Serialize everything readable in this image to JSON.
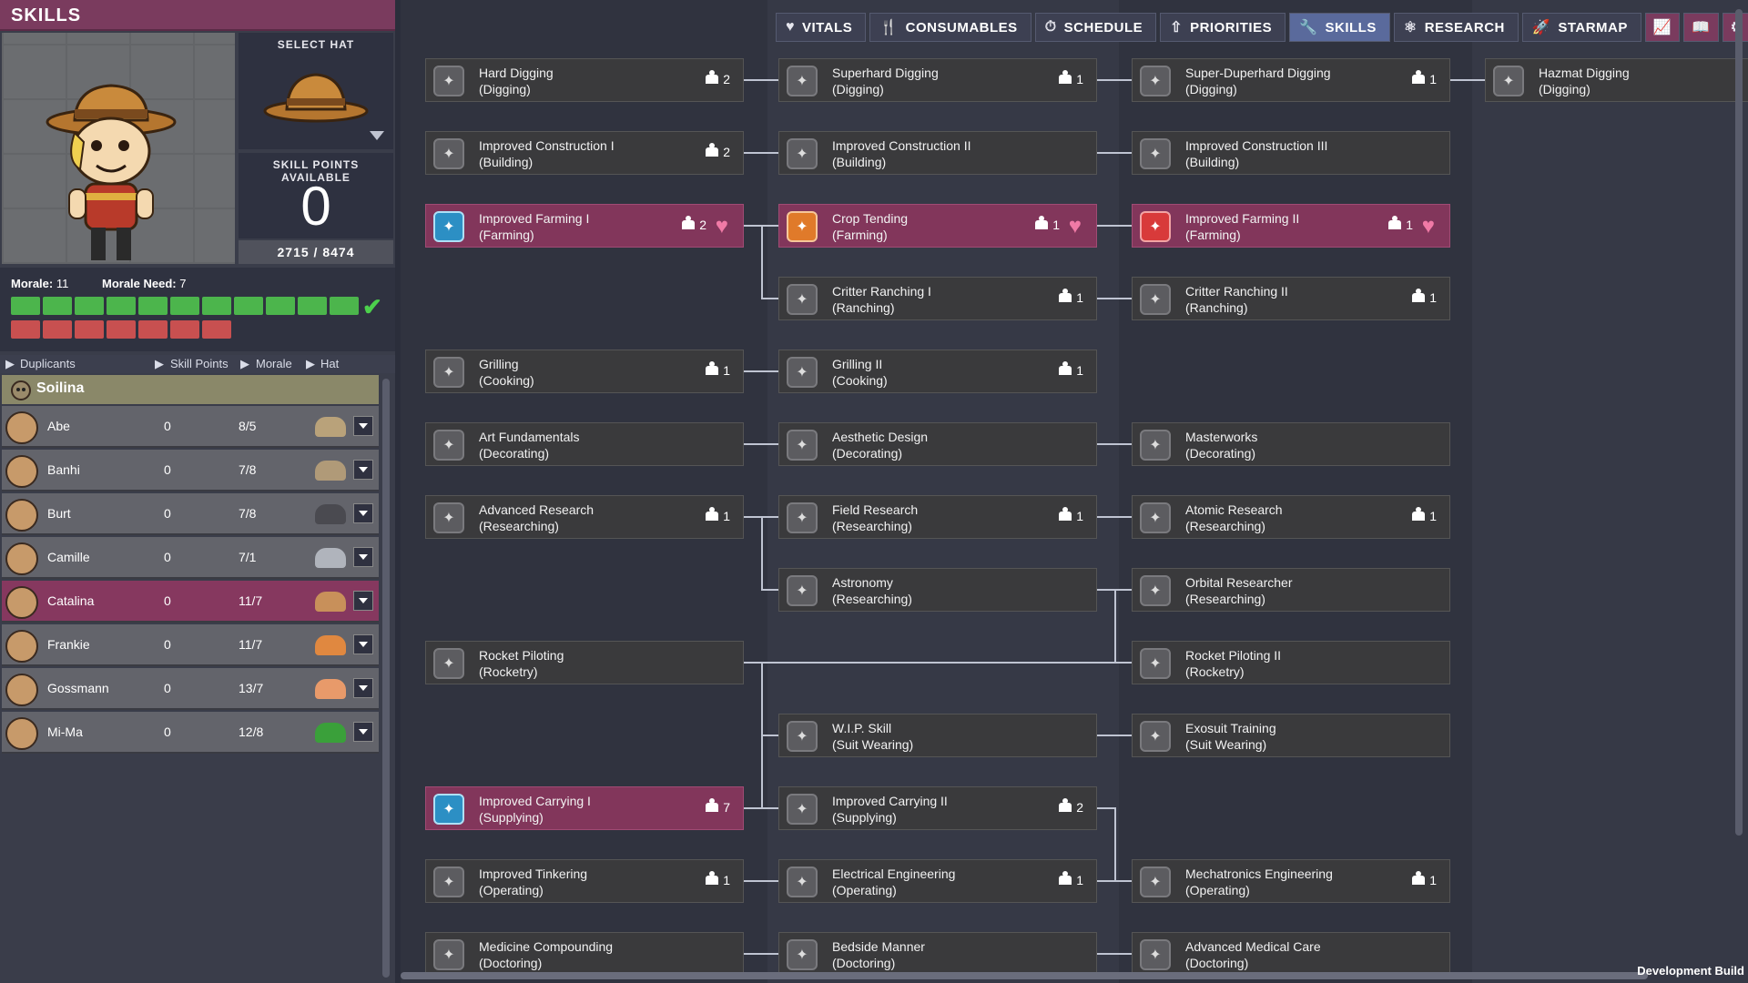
{
  "left": {
    "title": "SKILLS",
    "select_hat_label": "SELECT HAT",
    "skill_points_label": "SKILL POINTS AVAILABLE",
    "skill_points": "0",
    "xp": "2715 / 8474",
    "morale_label": "Morale:",
    "morale_value": "11",
    "morale_need_label": "Morale Need:",
    "morale_need_value": "7",
    "morale_green_cells": 11,
    "morale_red_cells": 7,
    "headers": [
      "Duplicants",
      "Skill Points",
      "Morale",
      "Hat"
    ],
    "group": "Soilina",
    "duplicants": [
      {
        "name": "Abe",
        "points": "0",
        "morale": "8/5",
        "hat_color": "#b9a27a"
      },
      {
        "name": "Banhi",
        "points": "0",
        "morale": "7/8",
        "hat_color": "#b09a78"
      },
      {
        "name": "Burt",
        "points": "0",
        "morale": "7/8",
        "hat_color": "#4a4a50"
      },
      {
        "name": "Camille",
        "points": "0",
        "morale": "7/1",
        "hat_color": "#b0b4bc"
      },
      {
        "name": "Catalina",
        "points": "0",
        "morale": "11/7",
        "hat_color": "#c8905a",
        "selected": true
      },
      {
        "name": "Frankie",
        "points": "0",
        "morale": "11/7",
        "hat_color": "#e08840"
      },
      {
        "name": "Gossmann",
        "points": "0",
        "morale": "13/7",
        "hat_color": "#e89a6a"
      },
      {
        "name": "Mi-Ma",
        "points": "0",
        "morale": "12/8",
        "hat_color": "#3aa03a"
      }
    ]
  },
  "nav": [
    {
      "label": "VITALS",
      "icon": "heart-icon",
      "glyph": "♥"
    },
    {
      "label": "CONSUMABLES",
      "icon": "utensils-icon",
      "glyph": "🍴"
    },
    {
      "label": "SCHEDULE",
      "icon": "stopwatch-icon",
      "glyph": "⏱"
    },
    {
      "label": "PRIORITIES",
      "icon": "priorities-icon",
      "glyph": "⇧"
    },
    {
      "label": "SKILLS",
      "icon": "wrench-icon",
      "glyph": "🔧",
      "active": true
    },
    {
      "label": "RESEARCH",
      "icon": "research-icon",
      "glyph": "⚛"
    },
    {
      "label": "STARMAP",
      "icon": "rocket-icon",
      "glyph": "🚀"
    }
  ],
  "nav_icons": [
    {
      "icon": "chart-icon",
      "glyph": "📈"
    },
    {
      "icon": "book-icon",
      "glyph": "📖"
    },
    {
      "icon": "gear-icon",
      "glyph": "⚙"
    }
  ],
  "skills": [
    {
      "id": "hard-digging",
      "name": "Hard Digging",
      "group": "(Digging)",
      "count": "2",
      "col": 0,
      "row": 0
    },
    {
      "id": "superhard-digging",
      "name": "Superhard Digging",
      "group": "(Digging)",
      "count": "1",
      "col": 1,
      "row": 0
    },
    {
      "id": "super-duperhard-digging",
      "name": "Super-Duperhard Digging",
      "group": "(Digging)",
      "count": "1",
      "col": 2,
      "row": 0
    },
    {
      "id": "hazmat-digging",
      "name": "Hazmat Digging",
      "group": "(Digging)",
      "count": "",
      "col": 3,
      "row": 0
    },
    {
      "id": "improved-construction-1",
      "name": "Improved Construction I",
      "group": "(Building)",
      "count": "2",
      "col": 0,
      "row": 1
    },
    {
      "id": "improved-construction-2",
      "name": "Improved Construction II",
      "group": "(Building)",
      "count": "",
      "col": 1,
      "row": 1
    },
    {
      "id": "improved-construction-3",
      "name": "Improved Construction III",
      "group": "(Building)",
      "count": "",
      "col": 2,
      "row": 1
    },
    {
      "id": "improved-farming-1",
      "name": "Improved Farming I",
      "group": "(Farming)",
      "count": "2",
      "col": 0,
      "row": 2,
      "owned": true,
      "heart": true,
      "icon_color": "blue"
    },
    {
      "id": "crop-tending",
      "name": "Crop Tending",
      "group": "(Farming)",
      "count": "1",
      "col": 1,
      "row": 2,
      "owned": true,
      "heart": true,
      "icon_color": "orange"
    },
    {
      "id": "improved-farming-2",
      "name": "Improved Farming II",
      "group": "(Farming)",
      "count": "1",
      "col": 2,
      "row": 2,
      "owned": true,
      "heart": true,
      "icon_color": "red"
    },
    {
      "id": "critter-ranching-1",
      "name": "Critter Ranching I",
      "group": "(Ranching)",
      "count": "1",
      "col": 1,
      "row": 3
    },
    {
      "id": "critter-ranching-2",
      "name": "Critter Ranching II",
      "group": "(Ranching)",
      "count": "1",
      "col": 2,
      "row": 3
    },
    {
      "id": "grilling",
      "name": "Grilling",
      "group": "(Cooking)",
      "count": "1",
      "col": 0,
      "row": 4
    },
    {
      "id": "grilling-2",
      "name": "Grilling II",
      "group": "(Cooking)",
      "count": "1",
      "col": 1,
      "row": 4
    },
    {
      "id": "art-fundamentals",
      "name": "Art Fundamentals",
      "group": "(Decorating)",
      "count": "",
      "col": 0,
      "row": 5
    },
    {
      "id": "aesthetic-design",
      "name": "Aesthetic Design",
      "group": "(Decorating)",
      "count": "",
      "col": 1,
      "row": 5
    },
    {
      "id": "masterworks",
      "name": "Masterworks",
      "group": "(Decorating)",
      "count": "",
      "col": 2,
      "row": 5
    },
    {
      "id": "advanced-research",
      "name": "Advanced Research",
      "group": "(Researching)",
      "count": "1",
      "col": 0,
      "row": 6
    },
    {
      "id": "field-research",
      "name": "Field Research",
      "group": "(Researching)",
      "count": "1",
      "col": 1,
      "row": 6
    },
    {
      "id": "atomic-research",
      "name": "Atomic Research",
      "group": "(Researching)",
      "count": "1",
      "col": 2,
      "row": 6
    },
    {
      "id": "astronomy",
      "name": "Astronomy",
      "group": "(Researching)",
      "count": "",
      "col": 1,
      "row": 7
    },
    {
      "id": "orbital-researcher",
      "name": "Orbital Researcher",
      "group": "(Researching)",
      "count": "",
      "col": 2,
      "row": 7
    },
    {
      "id": "rocket-piloting",
      "name": "Rocket Piloting",
      "group": "(Rocketry)",
      "count": "",
      "col": 0,
      "row": 8
    },
    {
      "id": "rocket-piloting-2",
      "name": "Rocket Piloting II",
      "group": "(Rocketry)",
      "count": "",
      "col": 2,
      "row": 8
    },
    {
      "id": "wip-skill",
      "name": "W.I.P. Skill",
      "group": "(Suit Wearing)",
      "count": "",
      "col": 1,
      "row": 9
    },
    {
      "id": "exosuit-training",
      "name": "Exosuit Training",
      "group": "(Suit Wearing)",
      "count": "",
      "col": 2,
      "row": 9
    },
    {
      "id": "improved-carrying-1",
      "name": "Improved Carrying I",
      "group": "(Supplying)",
      "count": "7",
      "col": 0,
      "row": 10,
      "owned": true,
      "icon_color": "blue"
    },
    {
      "id": "improved-carrying-2",
      "name": "Improved Carrying II",
      "group": "(Supplying)",
      "count": "2",
      "col": 1,
      "row": 10
    },
    {
      "id": "improved-tinkering",
      "name": "Improved Tinkering",
      "group": "(Operating)",
      "count": "1",
      "col": 0,
      "row": 11
    },
    {
      "id": "electrical-engineering",
      "name": "Electrical Engineering",
      "group": "(Operating)",
      "count": "1",
      "col": 1,
      "row": 11
    },
    {
      "id": "mechatronics-engineering",
      "name": "Mechatronics Engineering",
      "group": "(Operating)",
      "count": "1",
      "col": 2,
      "row": 11
    },
    {
      "id": "medicine-compounding",
      "name": "Medicine Compounding",
      "group": "(Doctoring)",
      "count": "",
      "col": 0,
      "row": 12
    },
    {
      "id": "bedside-manner",
      "name": "Bedside Manner",
      "group": "(Doctoring)",
      "count": "",
      "col": 1,
      "row": 12
    },
    {
      "id": "advanced-medical-care",
      "name": "Advanced Medical Care",
      "group": "(Doctoring)",
      "count": "",
      "col": 2,
      "row": 12
    }
  ],
  "footer": "Development Build"
}
